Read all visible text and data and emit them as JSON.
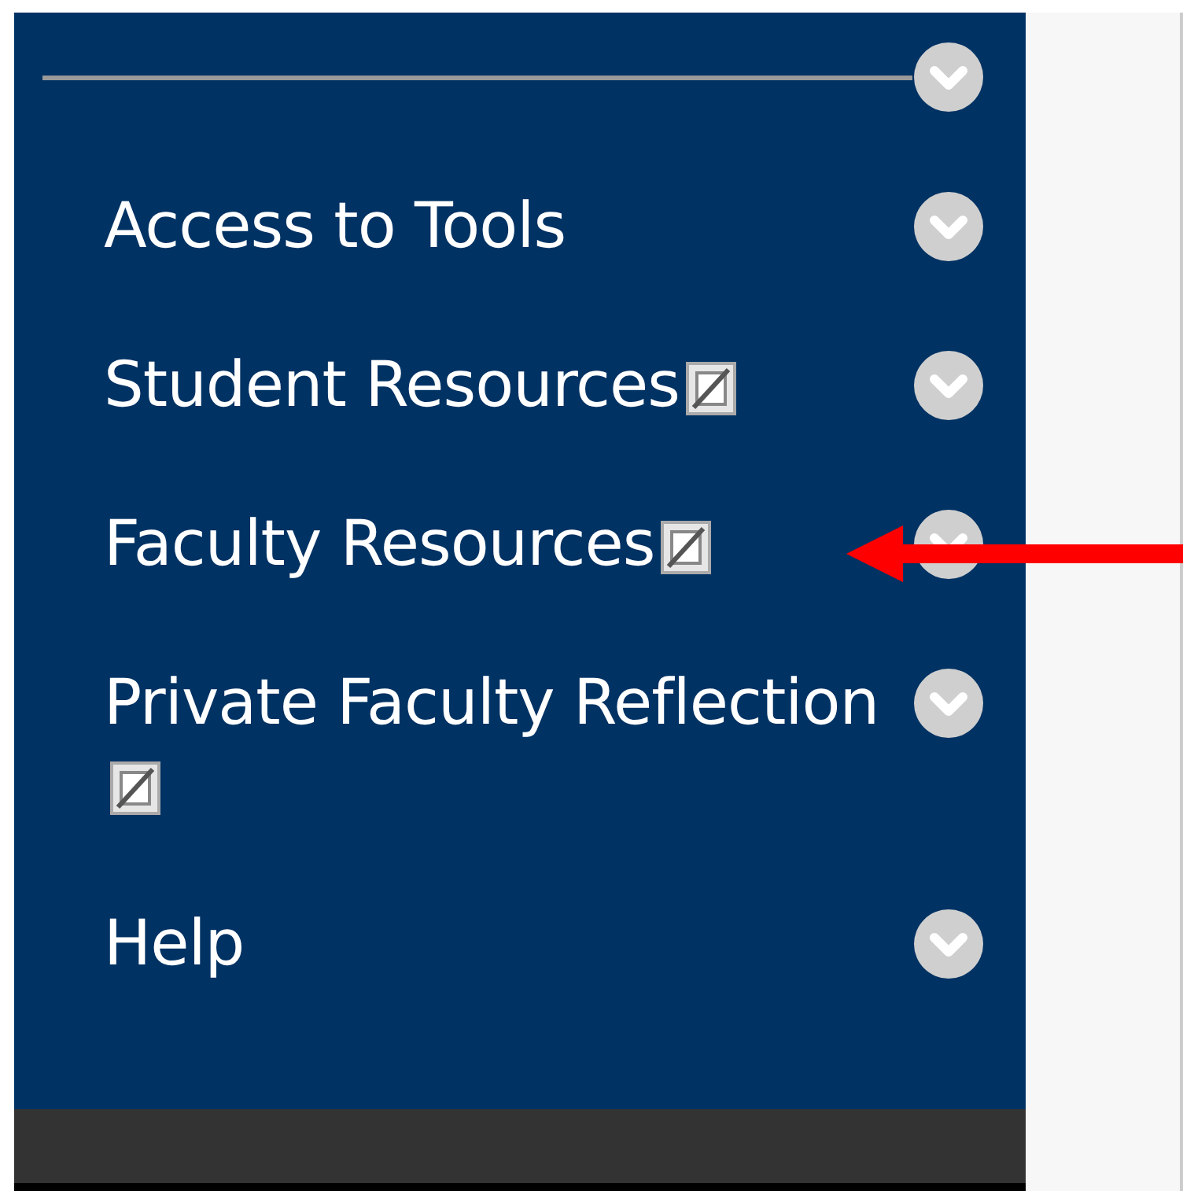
{
  "menu_items": [
    {
      "label": "Access to Tools",
      "hidden_icon": false
    },
    {
      "label": "Student Resources",
      "hidden_icon": true
    },
    {
      "label": "Faculty Resources",
      "hidden_icon": true
    },
    {
      "label": "Private Faculty Reflection",
      "hidden_icon": true
    },
    {
      "label": "Help",
      "hidden_icon": false
    }
  ]
}
